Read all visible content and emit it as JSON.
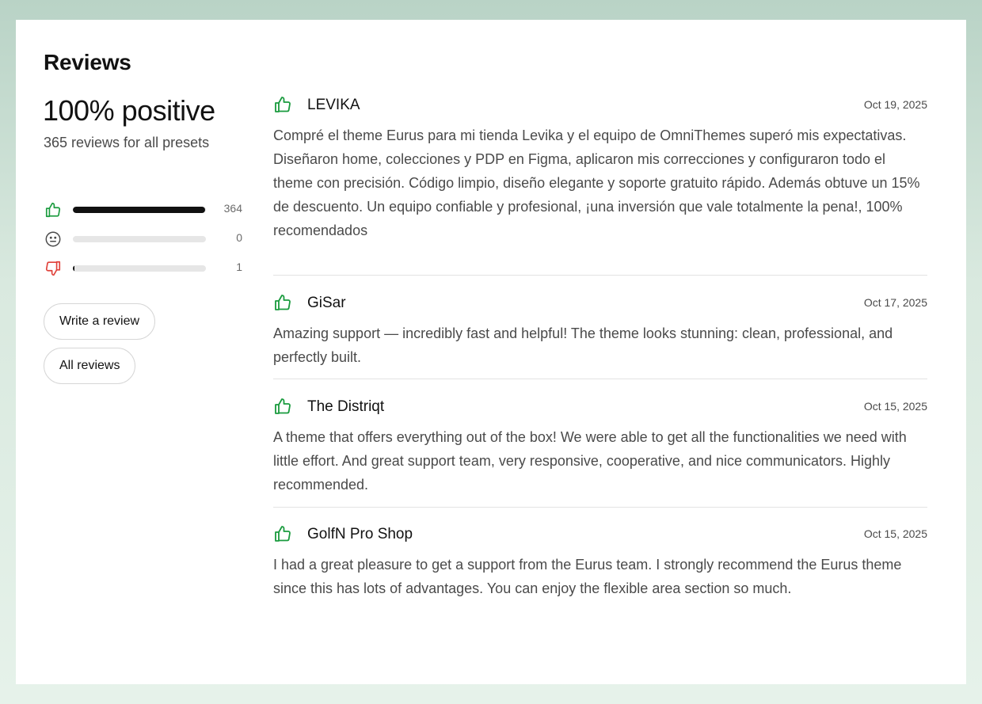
{
  "heading": "Reviews",
  "summary": {
    "headline": "100% positive",
    "subtext": "365 reviews for all presets"
  },
  "distribution": [
    {
      "type": "positive",
      "icon": "thumbs-up-icon",
      "count": "364",
      "fraction": 0.997,
      "color": "#1a9b3e"
    },
    {
      "type": "neutral",
      "icon": "neutral-face-icon",
      "count": "0",
      "fraction": 0.0,
      "color": "#6b6b6b"
    },
    {
      "type": "negative",
      "icon": "thumbs-down-icon",
      "count": "1",
      "fraction": 0.003,
      "color": "#e0413a"
    }
  ],
  "buttons": {
    "write_review": "Write a review",
    "all_reviews": "All reviews"
  },
  "reviews": [
    {
      "author": "LEVIKA",
      "date": "Oct 19, 2025",
      "sentiment": "positive",
      "text": "Compré el theme Eurus para mi tienda Levika y el equipo de OmniThemes superó mis expectativas. Diseñaron home, colecciones y PDP en Figma, aplicaron mis correcciones y configuraron todo el theme con precisión. Código limpio, diseño elegante y soporte gratuito rápido. Además obtuve un 15% de descuento. Un equipo confiable y profesional, ¡una inversión que vale totalmente la pena!, 100% recomendados"
    },
    {
      "author": "GiSar",
      "date": "Oct 17, 2025",
      "sentiment": "positive",
      "text": "Amazing support — incredibly fast and helpful! The theme looks stunning: clean, professional, and perfectly built."
    },
    {
      "author": "The Distriqt",
      "date": "Oct 15, 2025",
      "sentiment": "positive",
      "text": "A theme that offers everything out of the box! We were able to get all the functionalities we need with little effort. And great support team, very responsive, cooperative, and nice communicators. Highly recommended."
    },
    {
      "author": "GolfN Pro Shop",
      "date": "Oct 15, 2025",
      "sentiment": "positive",
      "text": "I had a great pleasure to get a support from the Eurus team. I strongly recommend the Eurus theme since this has lots of advantages. You can enjoy the flexible area section so much."
    }
  ],
  "colors": {
    "accent_green": "#1a9b3e",
    "negative_red": "#e0413a",
    "text_primary": "#121212",
    "text_secondary": "#4a4a4a"
  }
}
